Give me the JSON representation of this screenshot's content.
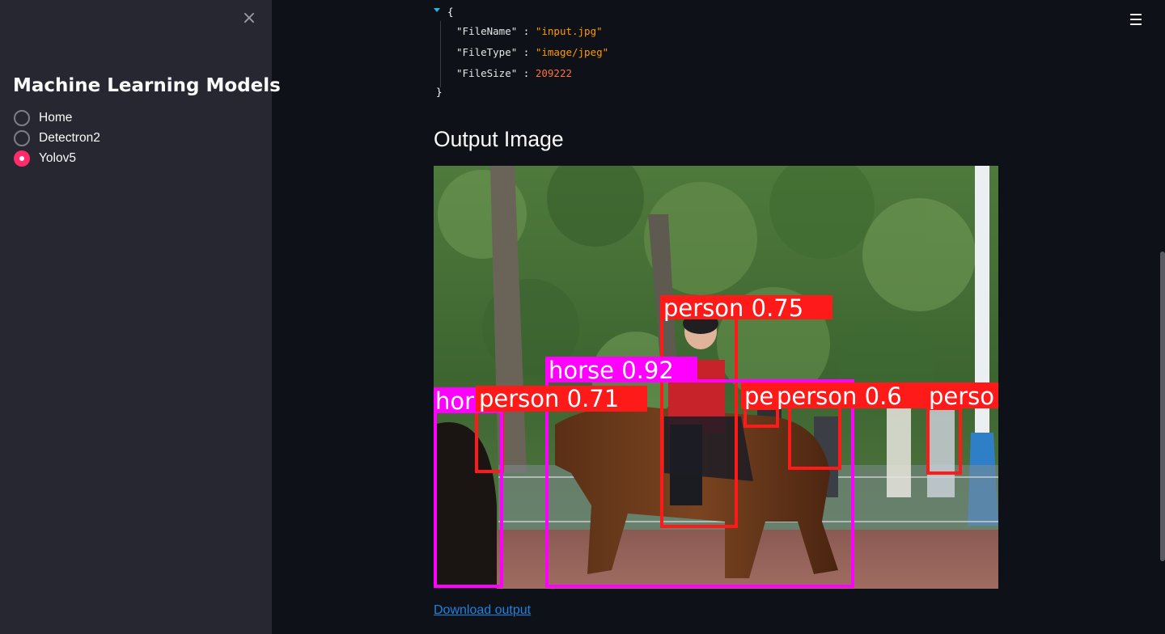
{
  "sidebar": {
    "close_icon": "×",
    "title": "Machine Learning Models",
    "options": [
      {
        "label": "Home",
        "selected": false
      },
      {
        "label": "Detectron2",
        "selected": false
      },
      {
        "label": "Yolov5",
        "selected": true
      }
    ]
  },
  "header": {
    "menu_icon": "☰"
  },
  "json_output": {
    "open_brace": "{",
    "close_brace": "}",
    "entries": [
      {
        "key": "\"FileName\"",
        "value": "\"input.jpg\"",
        "type": "string"
      },
      {
        "key": "\"FileType\"",
        "value": "\"image/jpeg\"",
        "type": "string"
      },
      {
        "key": "\"FileSize\"",
        "value": "209222",
        "type": "number"
      }
    ],
    "separator": " : "
  },
  "output": {
    "title": "Output Image",
    "detections": [
      {
        "label": "person 0.75",
        "color": "#ff1a1a"
      },
      {
        "label": "horse 0.92",
        "color": "#ff00ff"
      },
      {
        "label": "person 0.71",
        "color": "#ff1a1a"
      },
      {
        "label": "hor",
        "color": "#ff00ff"
      },
      {
        "label": "pe",
        "color": "#ff1a1a"
      },
      {
        "label": "person 0.6",
        "color": "#ff1a1a"
      },
      {
        "label": "perso",
        "color": "#ff1a1a"
      }
    ],
    "download_label": "Download output"
  },
  "colors": {
    "background": "#0e1117",
    "sidebar": "#262730",
    "accent": "#ff2b6a",
    "link": "#1c83e1"
  }
}
